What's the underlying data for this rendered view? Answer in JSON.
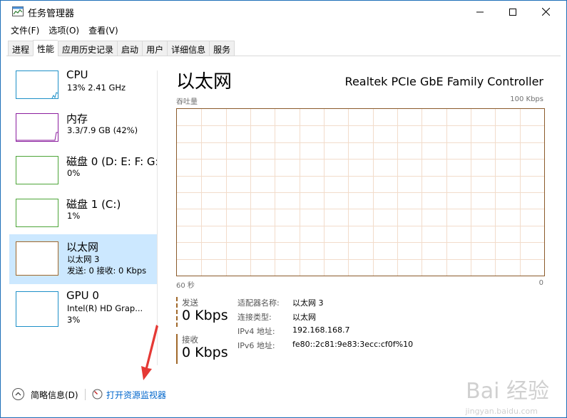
{
  "window": {
    "title": "任务管理器",
    "border_color": "#1e6fb8"
  },
  "menu": [
    {
      "label": "文件(F)"
    },
    {
      "label": "选项(O)"
    },
    {
      "label": "查看(V)"
    }
  ],
  "tabs": [
    {
      "label": "进程",
      "active": false
    },
    {
      "label": "性能",
      "active": true
    },
    {
      "label": "应用历史记录",
      "active": false
    },
    {
      "label": "启动",
      "active": false
    },
    {
      "label": "用户",
      "active": false
    },
    {
      "label": "详细信息",
      "active": false
    },
    {
      "label": "服务",
      "active": false
    }
  ],
  "sidebar": {
    "items": [
      {
        "title": "CPU",
        "sub": "13% 2.41 GHz",
        "sub2": "",
        "color": "#1e90c8"
      },
      {
        "title": "内存",
        "sub": "3.3/7.9 GB (42%)",
        "sub2": "",
        "color": "#8b1e9e"
      },
      {
        "title": "磁盘 0 (D: E: F: G:",
        "sub": "0%",
        "sub2": "",
        "color": "#4da538"
      },
      {
        "title": "磁盘 1 (C:)",
        "sub": "1%",
        "sub2": "",
        "color": "#4da538"
      },
      {
        "title": "以太网",
        "sub": "以太网 3",
        "sub2": "发送: 0 接收: 0 Kbps",
        "color": "#a0682a"
      },
      {
        "title": "GPU 0",
        "sub": "Intel(R) HD Grap...",
        "sub2": "3%",
        "color": "#1e90c8"
      }
    ],
    "active_color": "#cce8ff"
  },
  "main": {
    "title": "以太网",
    "adapter": "Realtek PCIe GbE Family Controller",
    "graph_label": "吞吐量",
    "graph_max": "100 Kbps",
    "graph_time": "60 秒",
    "graph_zero": "0",
    "graph_color": "#8b5a2b",
    "grid_color": "#f2dccb",
    "send": {
      "label": "发送",
      "value": "0 Kbps",
      "color": "#a0682a"
    },
    "receive": {
      "label": "接收",
      "value": "0 Kbps",
      "color": "#a0682a"
    },
    "props": [
      {
        "key": "适配器名称:",
        "value": "以太网 3"
      },
      {
        "key": "连接类型:",
        "value": "以太网"
      },
      {
        "key": "IPv4 地址:",
        "value": "192.168.168.7"
      },
      {
        "key": "IPv6 地址:",
        "value": "fe80::2c81:9e83:3ecc:cf0f%10"
      }
    ]
  },
  "footer": {
    "fewer_details": "简略信息(D)",
    "open_monitor": "打开资源监视器"
  },
  "watermark": {
    "text": "Bai 经验",
    "sub": "jingyan.baidu.com"
  }
}
